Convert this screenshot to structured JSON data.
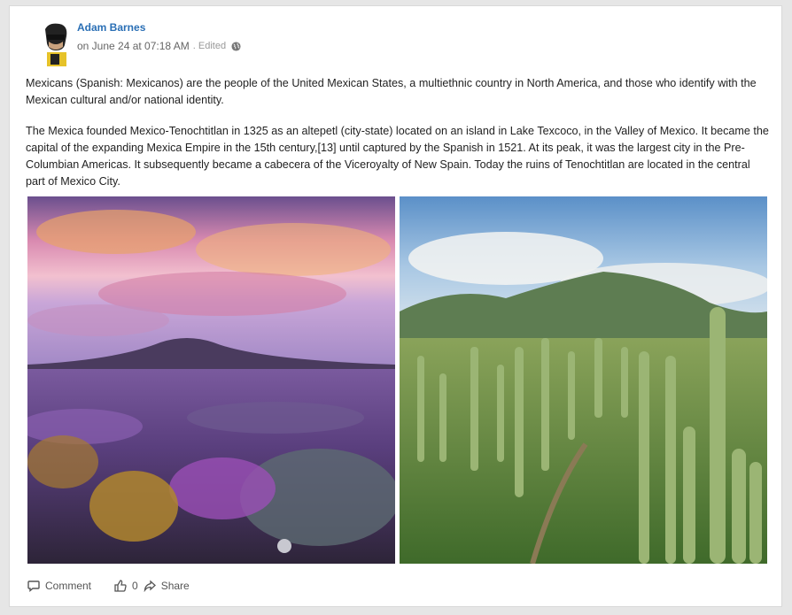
{
  "post": {
    "author": "Adam Barnes",
    "date": "on June 24 at 07:18 AM",
    "edited": ". Edited",
    "paragraphs": [
      "Mexicans (Spanish: Mexicanos) are the people of the United Mexican States, a multiethnic country in North America, and those who identify with the Mexican cultural and/or national identity.",
      "The Mexica founded Mexico-Tenochtitlan in 1325 as an altepetl (city-state) located on an island in Lake Texcoco, in the Valley of Mexico. It became the capital of the expanding Mexica Empire in the 15th century,[13] until captured by the Spanish in 1521. At its peak, it was the largest city in the Pre-Columbian Americas. It subsequently became a cabecera of the Viceroyalty of New Spain. Today the ruins of Tenochtitlan are located in the central part of Mexico City."
    ]
  },
  "actions": {
    "comment_label": "Comment",
    "like_count": "0",
    "share_label": "Share"
  },
  "icons": {
    "comment": "comment-icon",
    "like": "thumbs-up-icon",
    "share": "share-icon",
    "privacy": "globe-icon"
  }
}
